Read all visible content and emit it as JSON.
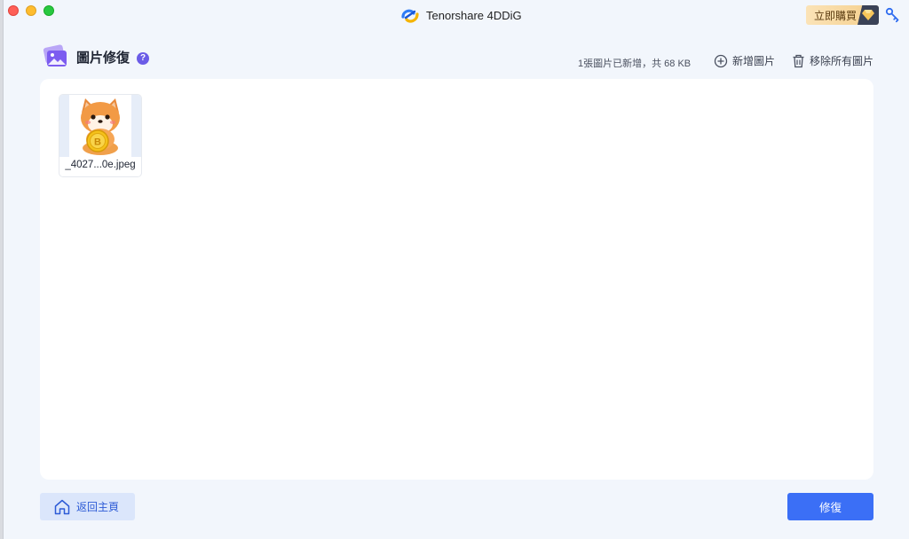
{
  "window": {
    "app_title": "Tenorshare 4DDiG",
    "buy_label": "立即購買"
  },
  "header": {
    "page_title": "圖片修復",
    "help_label": "?",
    "summary": "1張圖片已新增，共 68 KB",
    "add_label": "新增圖片",
    "remove_all_label": "移除所有圖片"
  },
  "files": [
    {
      "name": "_4027...0e.jpeg"
    }
  ],
  "footer": {
    "home_label": "返回主頁",
    "repair_label": "修復"
  },
  "colors": {
    "accent": "#3b6ff6",
    "background": "#f2f6fc",
    "help_badge": "#6b5ce7"
  }
}
